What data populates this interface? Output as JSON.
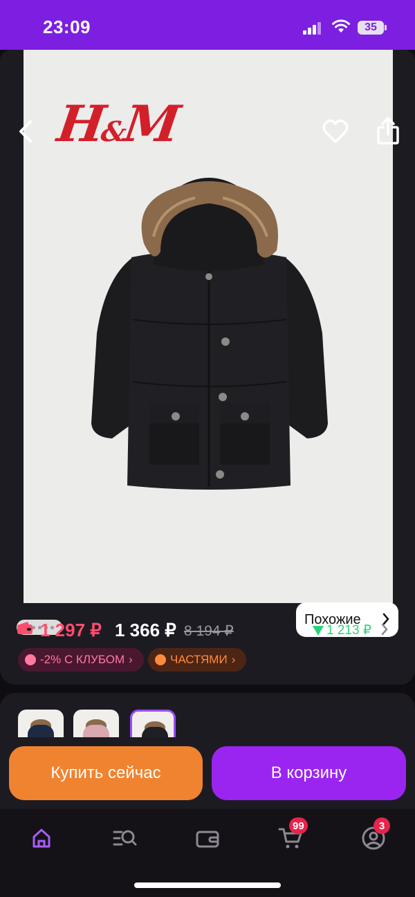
{
  "status": {
    "time": "23:09",
    "battery": "35"
  },
  "product": {
    "brand_logo": "H&M",
    "image_count": 5,
    "active_image": 1,
    "similar_label": "Похожие"
  },
  "prices": {
    "wallet_price": "1 297 ₽",
    "current_price": "1 366 ₽",
    "old_price": "8 194 ₽",
    "price_drop": "1 213 ₽"
  },
  "badges": {
    "club": "-2% С КЛУБОМ",
    "installments": "ЧАСТЯМИ"
  },
  "actions": {
    "buy_now": "Купить сейчас",
    "add_to_cart": "В корзину"
  },
  "tabs": {
    "cart_badge": "99",
    "profile_badge": "3"
  },
  "colors": {
    "accent": "#7c1fe0",
    "buy": "#f08330",
    "cart": "#9a25f0",
    "wallet_price": "#ff4d6d",
    "price_drop": "#2ed17a"
  }
}
